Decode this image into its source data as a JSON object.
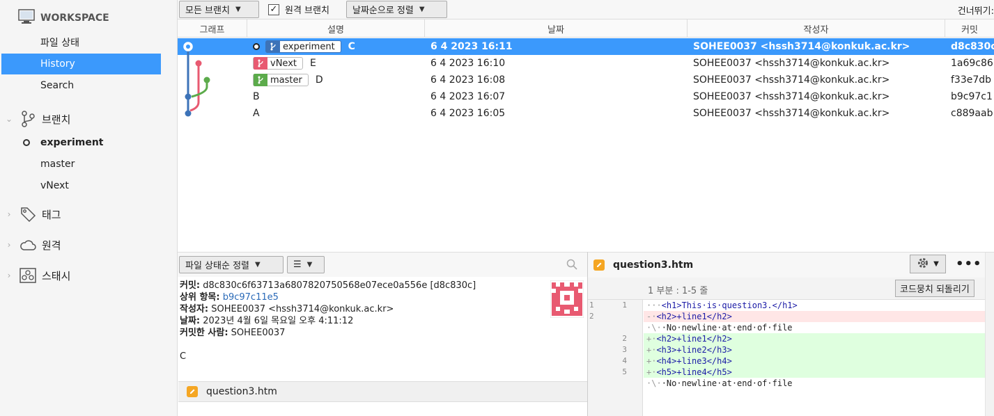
{
  "sidebar": {
    "workspace_label": "WORKSPACE",
    "items": [
      {
        "label": "파일 상태"
      },
      {
        "label": "History"
      },
      {
        "label": "Search"
      }
    ],
    "branches_label": "브랜치",
    "branches": [
      {
        "name": "experiment"
      },
      {
        "name": "master"
      },
      {
        "name": "vNext"
      }
    ],
    "tags_label": "태그",
    "remotes_label": "원격",
    "stash_label": "스태시"
  },
  "toolbar": {
    "branch_filter": "모든 브랜치",
    "remote_branch_label": "원격 브랜치",
    "remote_branch_checked": true,
    "sort_order": "날짜순으로 정렬",
    "skip_label": "건너뛰기:"
  },
  "table": {
    "headers": [
      "그래프",
      "설명",
      "날짜",
      "작성자",
      "커밋"
    ],
    "rows": [
      {
        "tag": "experiment",
        "tag_color": "#3d73b8",
        "desc": "C",
        "date": "6 4 2023 16:11",
        "author": "SOHEE0037 <hssh3714@konkuk.ac.kr>",
        "commit": "d8c830c"
      },
      {
        "tag": "vNext",
        "tag_color": "#e85a71",
        "desc": "E",
        "date": "6 4 2023 16:10",
        "author": "SOHEE0037 <hssh3714@konkuk.ac.kr>",
        "commit": "1a69c86"
      },
      {
        "tag": "master",
        "tag_color": "#5cab4b",
        "desc": "D",
        "date": "6 4 2023 16:08",
        "author": "SOHEE0037 <hssh3714@konkuk.ac.kr>",
        "commit": "f33e7db"
      },
      {
        "tag": "",
        "desc": "B",
        "date": "6 4 2023 16:07",
        "author": "SOHEE0037 <hssh3714@konkuk.ac.kr>",
        "commit": "b9c97c1"
      },
      {
        "tag": "",
        "desc": "A",
        "date": "6 4 2023 16:05",
        "author": "SOHEE0037 <hssh3714@konkuk.ac.kr>",
        "commit": "c889aab"
      }
    ]
  },
  "bottom": {
    "sort_label": "파일 상태순 정렬",
    "view_label": "☰",
    "commit_label": "커밋:",
    "commit_value": "d8c830c6f63713a6807820750568e07ece0a556e [d8c830c]",
    "parent_label": "상위 항목:",
    "parent_value": "b9c97c11e5",
    "author_label": "작성자:",
    "author_value": "SOHEE0037 <hssh3714@konkuk.ac.kr>",
    "date_label": "날짜:",
    "date_value": "2023년 4월 6일 목요일 오후 4:11:12",
    "committer_label": "커밋한 사람:",
    "committer_value": "SOHEE0037",
    "message": "C",
    "file_name": "question3.htm"
  },
  "diff": {
    "file_name": "question3.htm",
    "hunk_label": "1 부분 : 1-5 줄",
    "revert_label": "코드뭉치 되돌리기",
    "more_label": "•••",
    "lines": [
      {
        "old": "1",
        "new": "1",
        "type": "ctx",
        "prefix": "···",
        "text": "<h1>This·is·question3.</h1>"
      },
      {
        "old": "2",
        "new": "",
        "type": "del",
        "prefix": "-·",
        "text": "<h2>+line1</h2>"
      },
      {
        "old": "",
        "new": "",
        "type": "note",
        "prefix": "·\\·",
        "text": "·No·newline·at·end·of·file"
      },
      {
        "old": "",
        "new": "2",
        "type": "add",
        "prefix": "+·",
        "text": "<h2>+line1</h2>"
      },
      {
        "old": "",
        "new": "3",
        "type": "add",
        "prefix": "+·",
        "text": "<h3>+line2</h3>"
      },
      {
        "old": "",
        "new": "4",
        "type": "add",
        "prefix": "+·",
        "text": "<h4>+line3</h4>"
      },
      {
        "old": "",
        "new": "5",
        "type": "add",
        "prefix": "+·",
        "text": "<h5>+line4</h5>"
      },
      {
        "old": "",
        "new": "",
        "type": "note",
        "prefix": "·\\·",
        "text": "·No·newline·at·end·of·file"
      }
    ]
  },
  "icons": {
    "workspace": "monitor-icon",
    "branches": "branch-icon",
    "tags": "tag-icon",
    "remotes": "cloud-icon",
    "stash": "stash-icon",
    "file": "pencil-file-icon",
    "search": "search-icon",
    "gear": "gear-icon"
  }
}
